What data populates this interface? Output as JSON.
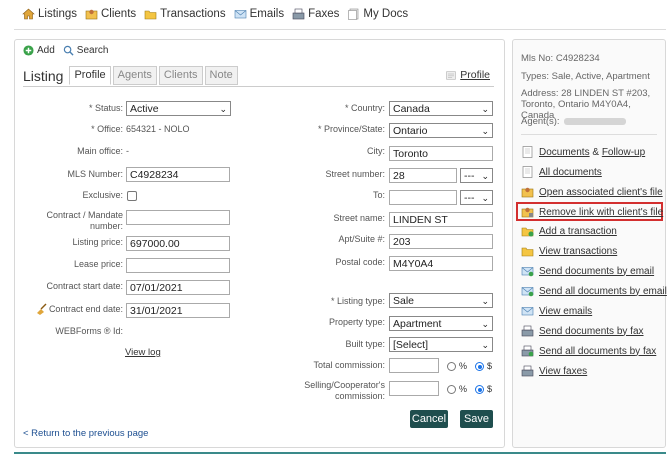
{
  "topnav": {
    "items": [
      {
        "label": "Listings",
        "icon": "home-icon"
      },
      {
        "label": "Clients",
        "icon": "clients-icon"
      },
      {
        "label": "Transactions",
        "icon": "folder-icon"
      },
      {
        "label": "Emails",
        "icon": "email-icon"
      },
      {
        "label": "Faxes",
        "icon": "fax-icon"
      },
      {
        "label": "My Docs",
        "icon": "docs-icon"
      }
    ]
  },
  "toolbar": {
    "add_label": "Add",
    "search_label": "Search"
  },
  "tabs": {
    "title": "Listing",
    "items": [
      "Profile",
      "Agents",
      "Clients",
      "Note"
    ],
    "profile_link": "Profile"
  },
  "form": {
    "status_label": "* Status:",
    "status_value": "Active",
    "office_label": "* Office:",
    "office_value": "654321 - NOLO",
    "main_office_label": "Main office:",
    "main_office_value": "-",
    "mls_label": "MLS Number:",
    "mls_value": "C4928234",
    "exclusive_label": "Exclusive:",
    "contract_mandate_label": "Contract / Mandate number:",
    "contract_mandate_value": "",
    "listing_price_label": "Listing price:",
    "listing_price_value": "697000.00",
    "lease_price_label": "Lease price:",
    "lease_price_value": "",
    "contract_start_label": "Contract start date:",
    "contract_start_value": "07/01/2021",
    "contract_end_label": "Contract end date:",
    "contract_end_value": "31/01/2021",
    "webforms_label": "WEBForms ® Id:",
    "view_log": "View log",
    "country_label": "* Country:",
    "country_value": "Canada",
    "province_label": "* Province/State:",
    "province_value": "Ontario",
    "city_label": "City:",
    "city_value": "Toronto",
    "street_number_label": "Street number:",
    "street_number_value": "28",
    "street_number_suffix": "---",
    "to_label": "To:",
    "to_value": "",
    "to_suffix": "---",
    "street_name_label": "Street name:",
    "street_name_value": "LINDEN ST",
    "apt_label": "Apt/Suite #:",
    "apt_value": "203",
    "postal_label": "Postal code:",
    "postal_value": "M4Y0A4",
    "listing_type_label": "* Listing type:",
    "listing_type_value": "Sale",
    "property_type_label": "Property type:",
    "property_type_value": "Apartment",
    "built_type_label": "Built type:",
    "built_type_value": "[Select]",
    "total_commission_label": "Total commission:",
    "selling_commission_label": "Selling/Cooperator's commission:",
    "percent_unit": "%",
    "dollar_unit": "$",
    "cancel_label": "Cancel",
    "save_label": "Save",
    "return_link": "< Return to the previous page"
  },
  "sidebar": {
    "mls_no": "Mls No:  C4928234",
    "types": "Types:  Sale, Active, Apartment",
    "address": "Address:  28 LINDEN ST #203, Toronto, Ontario M4Y0A4, Canada",
    "agents_label": "Agent(s):",
    "documents_part1": "Documents",
    "documents_amp": " & ",
    "documents_part2": "Follow-up",
    "actions": [
      {
        "label": "All documents",
        "icon": "document-icon"
      },
      {
        "label": "Open associated client's file",
        "icon": "client-file-icon"
      },
      {
        "label": "Remove link with client's file",
        "icon": "unlink-client-icon"
      },
      {
        "label": "Add a transaction",
        "icon": "add-transaction-icon"
      },
      {
        "label": "View transactions",
        "icon": "folder-icon"
      },
      {
        "label": "Send documents by email",
        "icon": "send-email-icon"
      },
      {
        "label": "Send all documents by email",
        "icon": "send-all-email-icon"
      },
      {
        "label": "View emails",
        "icon": "email-icon"
      },
      {
        "label": "Send documents by fax",
        "icon": "fax-icon"
      },
      {
        "label": "Send all documents by fax",
        "icon": "fax-all-icon"
      },
      {
        "label": "View faxes",
        "icon": "view-fax-icon"
      }
    ]
  },
  "colors": {
    "accent": "#1f4e4e",
    "highlight": "#d32f2f",
    "link": "#1d4f91",
    "radio": "#1a73e8"
  }
}
